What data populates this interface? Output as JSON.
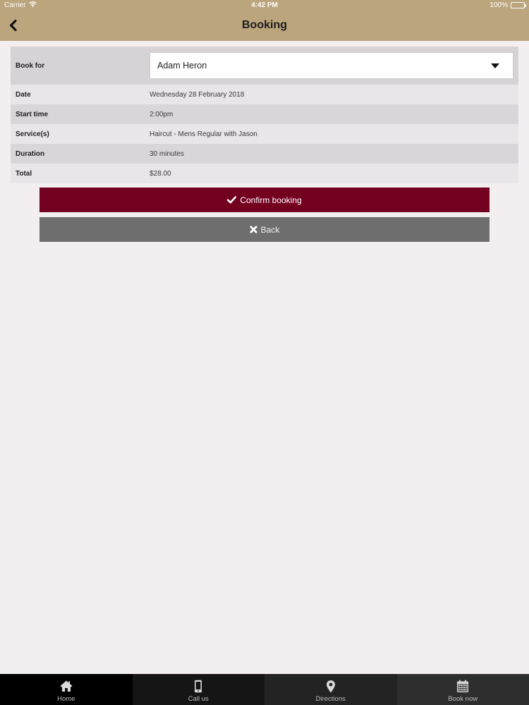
{
  "status_bar": {
    "carrier": "Carrier",
    "time": "4:42 PM",
    "battery": "100%",
    "battery_level": 1.0
  },
  "nav": {
    "title": "Booking",
    "back_icon": "chevron-left-icon"
  },
  "booking": {
    "book_for": {
      "label": "Book for",
      "selected": "Adam Heron"
    },
    "rows": [
      {
        "label": "Date",
        "value": "Wednesday 28 February 2018"
      },
      {
        "label": "Start time",
        "value": "2:00pm"
      },
      {
        "label": "Service(s)",
        "value": "Haircut - Mens Regular with Jason"
      },
      {
        "label": "Duration",
        "value": "30 minutes"
      },
      {
        "label": "Total",
        "value": "$28.00"
      }
    ]
  },
  "actions": {
    "confirm_label": "Confirm booking",
    "confirm_icon": "check-icon",
    "back_label": "Back",
    "back_icon": "x-icon"
  },
  "tabs": [
    {
      "label": "Home",
      "icon": "home-icon"
    },
    {
      "label": "Call us",
      "icon": "phone-icon"
    },
    {
      "label": "Directions",
      "icon": "map-pin-icon"
    },
    {
      "label": "Book now",
      "icon": "calendar-icon"
    }
  ],
  "colors": {
    "header": "#bba57c",
    "confirm": "#740020",
    "back": "#6e6e6e",
    "background": "#f3eff1"
  }
}
